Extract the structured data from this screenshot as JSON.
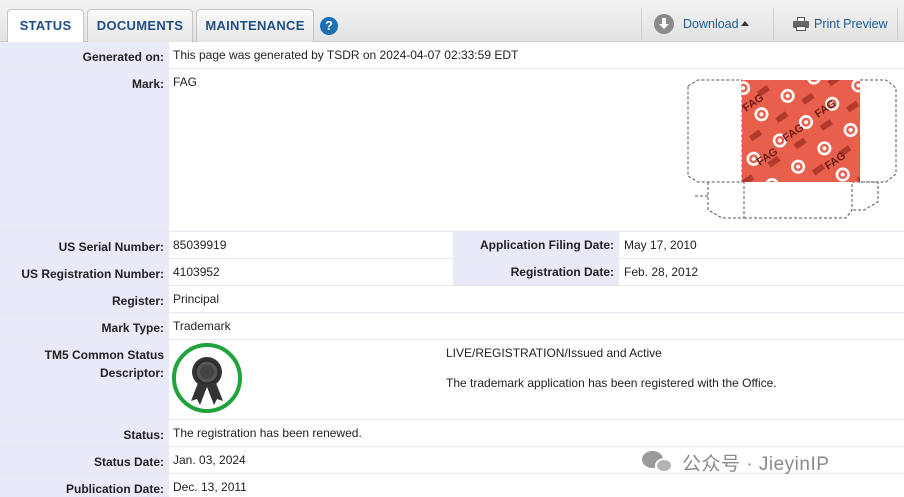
{
  "tabs": [
    {
      "label": "STATUS",
      "active": true
    },
    {
      "label": "DOCUMENTS",
      "active": false
    },
    {
      "label": "MAINTENANCE",
      "active": false
    }
  ],
  "help": {
    "glyph": "?"
  },
  "toolbar": {
    "download_label": "Download",
    "print_label": "Print Preview"
  },
  "icons": {
    "help": "help-icon",
    "download": "download-icon",
    "print": "printer-icon",
    "badge": "registered-seal-icon"
  },
  "colors": {
    "tab_text": "#1d4f86",
    "label_bg": "#e8ebf7",
    "badge_ring": "#1fa33a",
    "mark_red": "#e8604c"
  },
  "fields": {
    "generated_on": {
      "label": "Generated on:",
      "value": "This page was generated by TSDR on 2024-04-07 02:33:59 EDT"
    },
    "mark": {
      "label": "Mark:",
      "value": "FAG"
    },
    "serial": {
      "label": "US Serial Number:",
      "value": "85039919"
    },
    "filing_date": {
      "label": "Application Filing Date:",
      "value": "May 17, 2010"
    },
    "reg_number": {
      "label": "US Registration Number:",
      "value": "4103952"
    },
    "reg_date": {
      "label": "Registration Date:",
      "value": "Feb. 28, 2012"
    },
    "register": {
      "label": "Register:",
      "value": "Principal"
    },
    "mark_type": {
      "label": "Mark Type:",
      "value": "Trademark"
    },
    "tm5": {
      "label_line1": "TM5 Common Status",
      "label_line2": "Descriptor:",
      "status_line": "LIVE/REGISTRATION/Issued and Active",
      "description": "The trademark application has been registered with the Office."
    },
    "status": {
      "label": "Status:",
      "value": "The registration has been renewed."
    },
    "status_date": {
      "label": "Status Date:",
      "value": "Jan. 03, 2024"
    },
    "publication_date": {
      "label": "Publication Date:",
      "value": "Dec. 13, 2011"
    }
  },
  "mark_image": {
    "logo_text": "FAG"
  },
  "watermark": {
    "text": "公众号 · JieyinIP"
  }
}
